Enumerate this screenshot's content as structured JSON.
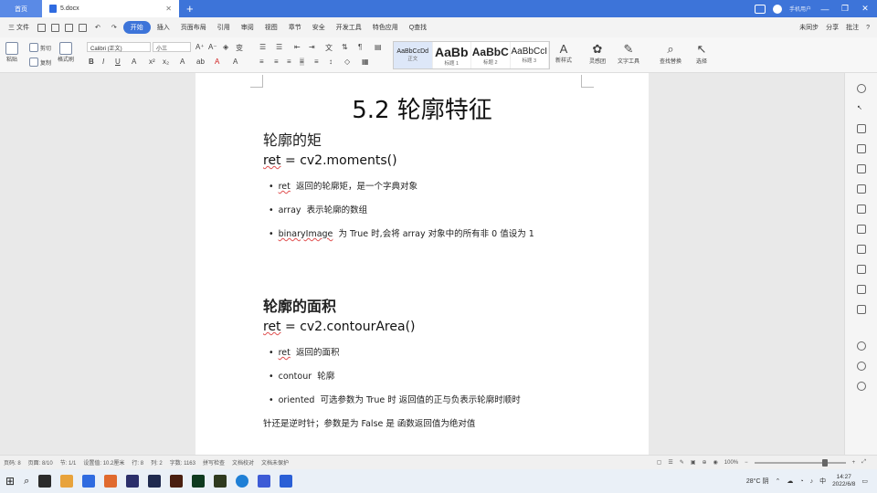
{
  "titlebar": {
    "home_tab": "首页",
    "doc_tab": "5.docx",
    "user": "手机用户",
    "min": "—",
    "max": "❐",
    "close": "✕"
  },
  "menubar": {
    "file": "三 文件",
    "tabs": [
      "开始",
      "插入",
      "页面布局",
      "引用",
      "审阅",
      "视图",
      "章节",
      "安全",
      "开发工具",
      "特色应用"
    ],
    "search": "Q查找",
    "sync": "未同步",
    "share": "分享",
    "comment": "批注",
    "help": "?"
  },
  "ribbon": {
    "paste": "粘贴",
    "cut": "剪切",
    "copy": "复制",
    "format_painter": "格式刷",
    "font_name": "Calibri (正文)",
    "font_size": "小三",
    "styles": [
      {
        "preview": "AaBbCcDd",
        "name": "正文"
      },
      {
        "preview": "AaBb",
        "name": "标题 1"
      },
      {
        "preview": "AaBbC",
        "name": "标题 2"
      },
      {
        "preview": "AaBbCcI",
        "name": "标题 3"
      }
    ],
    "new_style": "新样式",
    "dialog": "灵感团",
    "text_tools": "文字工具",
    "find_replace": "查找替换",
    "select": "选择"
  },
  "document": {
    "title": "5.2  轮廓特征",
    "section1": {
      "heading": "轮廓的矩",
      "code_var": "ret",
      "code_rest": " = cv2.moments()",
      "bullets": [
        {
          "key": "ret",
          "text": "返回的轮廓矩，是一个字典对象"
        },
        {
          "key": "array",
          "text": "表示轮廓的数组"
        },
        {
          "key": "binaryImage",
          "text": "为 True 时,会将 array 对象中的所有非 0 值设为 1"
        }
      ]
    },
    "section2": {
      "heading": "轮廓的面积",
      "code_var": "ret",
      "code_rest": " = cv2.contourArea()",
      "bullets": [
        {
          "key": "ret",
          "text": "返回的面积"
        },
        {
          "key": "contour",
          "text": "轮廓"
        },
        {
          "key": "oriented",
          "text": "可选参数为 True 时  返回值的正与负表示轮廓时顺时"
        }
      ],
      "continuation": "针还是逆时针；参数是为 False 是  函数返回值为绝对值"
    }
  },
  "statusbar": {
    "page": "页码: 8",
    "pages": "页面: 8/10",
    "section": "节: 1/1",
    "position": "设置值: 10.2厘米",
    "row": "行: 8",
    "col": "列: 2",
    "words": "字数: 1163",
    "spell": "拼写检查",
    "proof": "文档校对",
    "protect": "文档未保护",
    "zoom": "100%"
  },
  "taskbar": {
    "weather": "28°C 阴",
    "time": "14:27",
    "date": "2022/6/8",
    "ime": "中",
    "icon_colors": [
      "#e8a33c",
      "#2f6be0",
      "#e06a2f",
      "#2b2f6b",
      "#1f2a4f",
      "#4a1f10",
      "#0f3a1f",
      "#2f3a1f",
      "#1e7fd6",
      "#3d5bd6",
      "#2a5fd6"
    ]
  }
}
